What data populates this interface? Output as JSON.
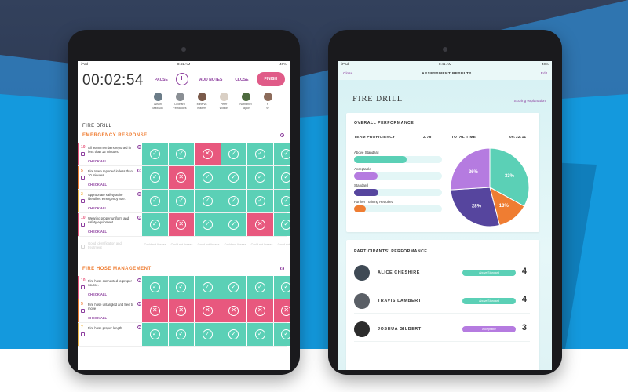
{
  "colors": {
    "green": "#5bd0b6",
    "pink": "#e8587e",
    "purple": "#8d3f9e",
    "orange": "#ef7d32",
    "indigo": "#56459e",
    "lilac": "#b57be0"
  },
  "left": {
    "status": {
      "left": "iPad",
      "center": "8:41 AM",
      "right": "40%"
    },
    "timer": "00:02:54",
    "controls": {
      "pause": "PAUSE",
      "add_notes": "ADD NOTES",
      "close": "CLOSE",
      "finish": "FINISH"
    },
    "participants": [
      {
        "first": "Alison",
        "last": "Mawson"
      },
      {
        "first": "Leonard",
        "last": "Fernandes"
      },
      {
        "first": "Minerva",
        "last": "Walters"
      },
      {
        "first": "Peter",
        "last": "Wilson"
      },
      {
        "first": "Nathaniel",
        "last": "Taylor"
      },
      {
        "first": "P",
        "last": "W"
      }
    ],
    "drill_title": "FIRE DRILL",
    "sections": [
      {
        "title": "EMERGENCY RESPONSE",
        "items": [
          {
            "num": "10",
            "text": "All team members reported in less than 15 minutes.",
            "check": "CHECK ALL",
            "bar": "#e8587e",
            "cells": [
              "g",
              "g",
              "p",
              "g",
              "g",
              "g"
            ]
          },
          {
            "num": "5",
            "text": "Fire team reported in less than 10 minutes.",
            "check": "CHECK ALL",
            "bar": "#ef7d32",
            "cells": [
              "g",
              "p",
              "g",
              "g",
              "g",
              "g"
            ]
          },
          {
            "num": "2",
            "text": "Appropriate safety attire identifies emergency role.",
            "check": "CHECK ALL",
            "bar": "#f2b94a",
            "cells": [
              "g",
              "g",
              "g",
              "g",
              "g",
              "g"
            ]
          },
          {
            "num": "10",
            "text": "Wearing proper uniform and safety equipment.",
            "check": "CHECK ALL",
            "bar": "#e8587e",
            "cells": [
              "g",
              "p",
              "g",
              "g",
              "p",
              "g"
            ]
          }
        ],
        "grey_text": "Good identification and treatment",
        "grey_cells": [
          "Could not Assess",
          "Could not Assess",
          "Could not Assess",
          "Could not Assess",
          "Could not Assess",
          "Could not Assess"
        ]
      },
      {
        "title": "FIRE HOSE MANAGEMENT",
        "items": [
          {
            "num": "10",
            "text": "Fire hose connected to proper source.",
            "check": "CHECK ALL",
            "bar": "#e8587e",
            "cells": [
              "g",
              "g",
              "g",
              "g",
              "g",
              "g"
            ]
          },
          {
            "num": "5",
            "text": "Fire hose untangled and free to move",
            "check": "CHECK ALL",
            "bar": "#ef7d32",
            "cells": [
              "p",
              "p",
              "p",
              "p",
              "p",
              "p"
            ]
          },
          {
            "num": "7",
            "text": "Fire hose proper length",
            "check": "",
            "bar": "#f2b94a",
            "cells": [
              "g",
              "g",
              "g",
              "g",
              "g",
              "g"
            ]
          }
        ]
      }
    ]
  },
  "right": {
    "status": {
      "left": "iPad",
      "center": "8:41 AM",
      "right": "40%"
    },
    "header": {
      "close": "Close",
      "title": "ASSESSMENT RESULTS",
      "edit": "Edit"
    },
    "title": "FIRE DRILL",
    "scoring": "Scoring explanation",
    "overall": {
      "heading": "OVERALL PERFORMANCE",
      "proficiency_label": "TEAM PROFICIENCY",
      "proficiency_value": "2.76",
      "time_label": "TOTAL TIME",
      "time_value": "06:32:11",
      "bars": [
        {
          "label": "Above Standard",
          "fraction": 0.6,
          "color": "#5bd0b6"
        },
        {
          "label": "Acceptable",
          "fraction": 0.27,
          "color": "#b57be0"
        },
        {
          "label": "Standard",
          "fraction": 0.28,
          "color": "#56459e"
        },
        {
          "label": "Further Training Required",
          "fraction": 0.13,
          "color": "#ef7d32"
        }
      ]
    },
    "chart_data": {
      "type": "pie",
      "slices": [
        {
          "label": "33%",
          "value": 33,
          "color": "#5bd0b6"
        },
        {
          "label": "13%",
          "value": 13,
          "color": "#ef7d32"
        },
        {
          "label": "28%",
          "value": 28,
          "color": "#56459e"
        },
        {
          "label": "26%",
          "value": 26,
          "color": "#b57be0"
        }
      ]
    },
    "participants_heading": "PARTICIPANTS' PERFORMANCE",
    "participants": [
      {
        "name": "ALICE CHESHIRE",
        "badge": "Above Standard",
        "badge_color": "#5bd0b6",
        "score": "4"
      },
      {
        "name": "TRAVIS LAMBERT",
        "badge": "Above Standard",
        "badge_color": "#5bd0b6",
        "score": "4"
      },
      {
        "name": "JOSHUA GILBERT",
        "badge": "Acceptable",
        "badge_color": "#b57be0",
        "score": "3"
      }
    ]
  }
}
